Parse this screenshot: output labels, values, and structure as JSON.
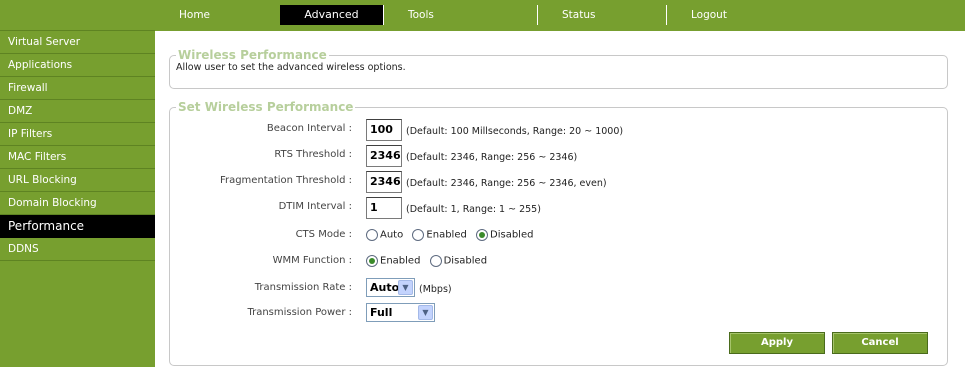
{
  "nav": {
    "tabs": [
      {
        "label": "Home",
        "active": false
      },
      {
        "label": "Advanced",
        "active": true
      },
      {
        "label": "Tools",
        "active": false
      },
      {
        "label": "Status",
        "active": false
      },
      {
        "label": "Logout",
        "active": false
      }
    ]
  },
  "sidebar": {
    "items": [
      {
        "label": "Virtual Server"
      },
      {
        "label": "Applications"
      },
      {
        "label": "Firewall"
      },
      {
        "label": "DMZ"
      },
      {
        "label": "IP Filters"
      },
      {
        "label": "MAC Filters"
      },
      {
        "label": "URL Blocking"
      },
      {
        "label": "Domain Blocking"
      },
      {
        "label": "Performance",
        "active": true
      },
      {
        "label": "DDNS"
      }
    ]
  },
  "info_section": {
    "title": "Wireless Performance",
    "description": "Allow user to set the advanced wireless options."
  },
  "form": {
    "title": "Set Wireless Performance",
    "beacon": {
      "label": "Beacon Interval :",
      "value": "100",
      "hint": "(Default: 100 Millseconds, Range: 20 ~ 1000)"
    },
    "rts": {
      "label": "RTS Threshold :",
      "value": "2346",
      "hint": "(Default: 2346, Range: 256 ~ 2346)"
    },
    "frag": {
      "label": "Fragmentation Threshold :",
      "value": "2346",
      "hint": "(Default: 2346, Range: 256 ~ 2346, even)"
    },
    "dtim": {
      "label": "DTIM Interval :",
      "value": "1",
      "hint": "(Default: 1, Range: 1 ~ 255)"
    },
    "cts": {
      "label": "CTS Mode :",
      "options": [
        "Auto",
        "Enabled",
        "Disabled"
      ],
      "selected": "Disabled"
    },
    "wmm": {
      "label": "WMM Function :",
      "options": [
        "Enabled",
        "Disabled"
      ],
      "selected": "Enabled"
    },
    "rate": {
      "label": "Transmission Rate :",
      "value": "Auto",
      "unit": "(Mbps)"
    },
    "power": {
      "label": "Transmission Power :",
      "value": "Full"
    },
    "apply_label": "Apply",
    "cancel_label": "Cancel"
  },
  "colors": {
    "accent": "#779f2f",
    "active_tab": "#000000",
    "legend": "#b7cf9c"
  }
}
